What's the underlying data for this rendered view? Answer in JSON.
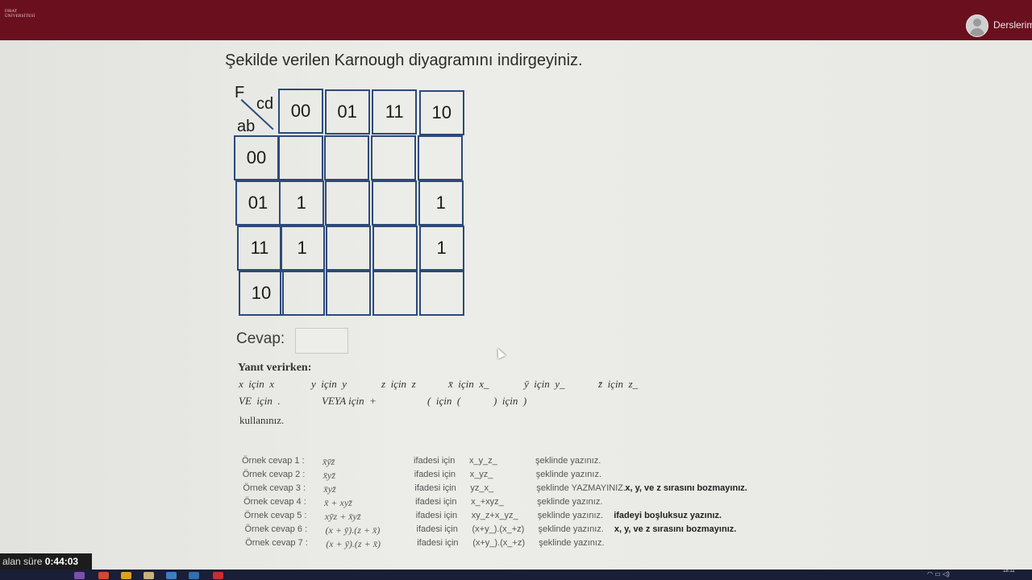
{
  "header": {
    "logo_line1": "FIRAT",
    "logo_line2": "ÜNİVERSİTESİ",
    "user_label": "Derslerim"
  },
  "question": {
    "text": "Şekilde verilen Karnough diyagramını indirgeyiniz."
  },
  "kmap": {
    "function_label": "F",
    "col_var_label": "cd",
    "row_var_label": "ab",
    "col_headers": [
      "00",
      "01",
      "11",
      "10"
    ],
    "row_headers": [
      "00",
      "01",
      "11",
      "10"
    ],
    "cells": [
      [
        "",
        "",
        "",
        ""
      ],
      [
        "1",
        "",
        "",
        "1"
      ],
      [
        "1",
        "",
        "",
        "1"
      ],
      [
        "",
        "",
        "",
        ""
      ]
    ]
  },
  "answer": {
    "label": "Cevap:",
    "value": ""
  },
  "instructions": {
    "title": "Yanıt verirken:",
    "row1": [
      {
        "expr": "x",
        "for": "için",
        "write": "x"
      },
      {
        "expr": "y",
        "for": "için",
        "write": "y"
      },
      {
        "expr": "z",
        "for": "için",
        "write": "z"
      },
      {
        "expr": "x̄",
        "for": "için",
        "write": "x_"
      },
      {
        "expr": "ȳ",
        "for": "için",
        "write": "y_"
      },
      {
        "expr": "z̄",
        "for": "için",
        "write": "z_"
      }
    ],
    "row2": [
      {
        "expr": "VE",
        "for": "için",
        "write": "."
      },
      {
        "expr": "VEYA",
        "for": "için",
        "write": "+"
      },
      {
        "expr": "(",
        "for": "için",
        "write": "("
      },
      {
        "expr": ")",
        "for": "için",
        "write": ")"
      }
    ],
    "footer": "kullanınız."
  },
  "examples": [
    {
      "label": "Örnek cevap 1 :",
      "math": "x̄ȳz̄",
      "ifadesi": "ifadesi için",
      "code": "x_y_z_",
      "note": "şeklinde yazınız.",
      "bold": ""
    },
    {
      "label": "Örnek cevap 2 :",
      "math": "x̄yz̄",
      "ifadesi": "ifadesi için",
      "code": "x_yz_",
      "note": "şeklinde yazınız.",
      "bold": ""
    },
    {
      "label": "Örnek cevap 3 :",
      "math": "x̄yz̄",
      "ifadesi": "ifadesi için",
      "code": "yz_x_",
      "note": "şeklinde YAZMAYINIZ.",
      "bold": "x, y, ve z sırasını bozmayınız."
    },
    {
      "label": "Örnek cevap 4 :",
      "math": "x̄ + xyz̄",
      "ifadesi": "ifadesi için",
      "code": "x_+xyz_",
      "note": "şeklinde yazınız.",
      "bold": ""
    },
    {
      "label": "Örnek cevap 5 :",
      "math": "xȳz + x̄yz̄",
      "ifadesi": "ifadesi için",
      "code": "xy_z+x_yz_",
      "note": "şeklinde yazınız.",
      "bold": "ifadeyi boşluksuz yazınız."
    },
    {
      "label": "Örnek cevap 6 :",
      "math": "(x + ȳ).(z + x̄)",
      "ifadesi": "ifadesi için",
      "code": "(x+y_).(x_+z)",
      "note": "şeklinde yazınız.",
      "bold": "x, y, ve z sırasını bozmayınız."
    },
    {
      "label": "Örnek cevap 7 :",
      "math": "(x + ȳ).(z + x̄)",
      "ifadesi": "ifadesi için",
      "code": "(x+y_).(x_+z)",
      "note": "şeklinde yazınız.",
      "bold": ""
    }
  ],
  "timer": {
    "label": "alan süre",
    "value": "0:44:03"
  },
  "system": {
    "clock": "18:11"
  },
  "colors": {
    "header_bg": "#6a0f1e",
    "grid_line": "#2c4a7a"
  }
}
